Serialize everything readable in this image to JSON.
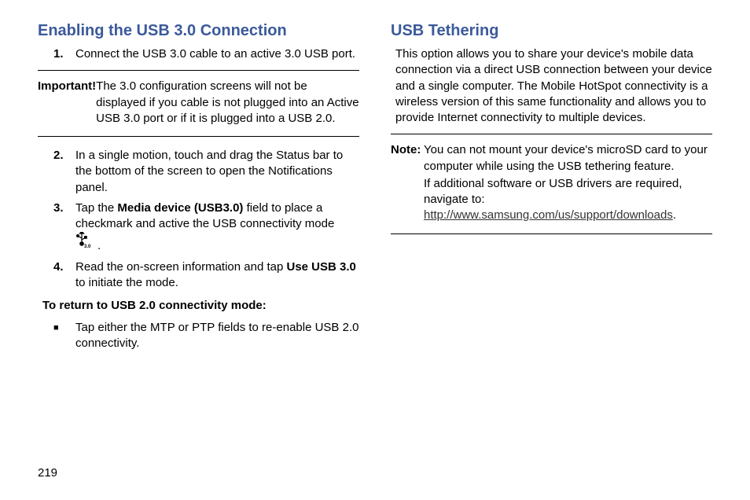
{
  "page_number": "219",
  "left": {
    "heading": "Enabling the USB 3.0 Connection",
    "steps": [
      {
        "num": "1.",
        "text": "Connect the USB 3.0 cable to an active 3.0 USB port."
      },
      {
        "num": "2.",
        "text": "In a single motion, touch and drag the Status bar to the bottom of the screen to open the Notifications panel."
      },
      {
        "num": "3.",
        "pre": "Tap the ",
        "bold": "Media device (USB3.0)",
        "post": " field to place a checkmark and active the USB connectivity mode "
      },
      {
        "num": "4.",
        "pre": "Read the on-screen information and tap ",
        "bold": "Use USB 3.0",
        "post": " to initiate the mode."
      }
    ],
    "important_label": "Important!",
    "important_text": " The 3.0 configuration screens will not be displayed if you cable is not plugged into an Active USB 3.0 port or if it is plugged into a USB 2.0.",
    "sub_heading": "To return to USB 2.0 connectivity mode:",
    "bullet": "Tap either the MTP or PTP fields to re-enable USB 2.0 connectivity.",
    "icon_period": ".",
    "icon_label": "3.0"
  },
  "right": {
    "heading": "USB Tethering",
    "intro": "This option allows you to share your device's mobile data connection via a direct USB connection between your device and a single computer. The Mobile HotSpot connectivity is a wireless version of this same functionality and allows you to provide Internet connectivity to multiple devices.",
    "note_label": "Note:",
    "note_text1": " You can not mount your device's microSD card to your computer while using the USB tethering feature.",
    "note_text2": "If additional software or USB drivers are required, navigate to: ",
    "note_link": "http://www.samsung.com/us/support/downloads",
    "note_period": "."
  }
}
